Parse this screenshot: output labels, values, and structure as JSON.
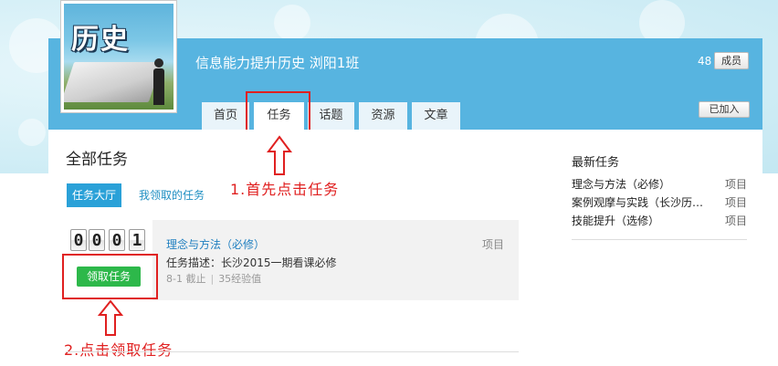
{
  "header": {
    "cover_text": "历史",
    "class_title": "信息能力提升历史 浏阳1班",
    "member_count": "48",
    "member_label": "成员",
    "joined_label": "已加入"
  },
  "tabs": [
    {
      "label": "首页"
    },
    {
      "label": "任务"
    },
    {
      "label": "话题"
    },
    {
      "label": "资源"
    },
    {
      "label": "文章"
    }
  ],
  "main": {
    "title": "全部任务",
    "subtabs": [
      "任务大厅",
      "我领取的任务"
    ],
    "task": {
      "digits": [
        "0",
        "0",
        "0",
        "1"
      ],
      "claim_label": "领取任务",
      "name": "理念与方法（必修）",
      "type": "项目",
      "description": "任务描述：长沙2015一期看课必修",
      "date": "8-1 截止",
      "exp": "35经验值"
    }
  },
  "sidebar": {
    "title": "最新任务",
    "items": [
      {
        "name": "理念与方法（必修）",
        "type": "项目"
      },
      {
        "name": "案例观摩与实践（长沙历…",
        "type": "项目"
      },
      {
        "name": "技能提升（选修）",
        "type": "项目"
      }
    ]
  },
  "annotations": {
    "hint1": "1.首先点击任务",
    "hint2": "2.点击领取任务",
    "color": "#e02020"
  },
  "colors": {
    "header_bg": "#57b4e0",
    "accent": "#2aa1d8",
    "claim_button": "#2db84a",
    "link": "#1f7fc0"
  }
}
